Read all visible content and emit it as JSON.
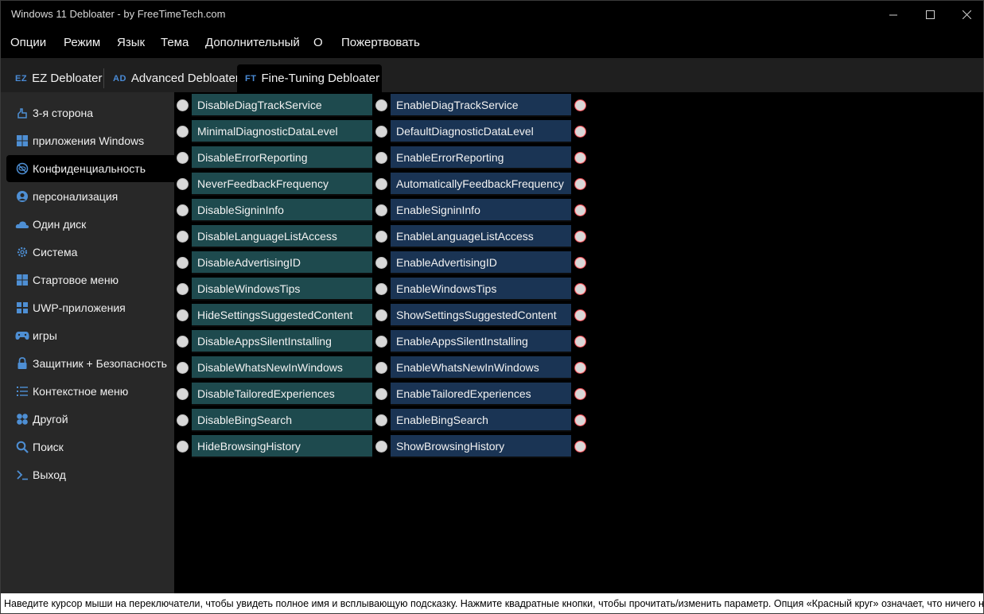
{
  "window": {
    "title": "Windows 11 Debloater - by FreeTimeTech.com"
  },
  "menu": [
    "Опции",
    "Режим",
    "Язык",
    "Тема",
    "Дополнительный",
    "О",
    "Пожертвовать"
  ],
  "tabs": [
    {
      "icon": "EZ",
      "label": "EZ Debloater"
    },
    {
      "icon": "AD",
      "label": "Advanced Debloater"
    },
    {
      "icon": "FT",
      "label": "Fine-Tuning Debloater"
    }
  ],
  "sidebar": [
    {
      "label": "3-я сторона",
      "icon": "hand-icon"
    },
    {
      "label": "приложения Windows",
      "icon": "windows-icon"
    },
    {
      "label": "Конфиденциальность",
      "icon": "privacy-eye-icon"
    },
    {
      "label": "персонализация",
      "icon": "person-icon"
    },
    {
      "label": "Один диск",
      "icon": "cloud-icon"
    },
    {
      "label": "Система",
      "icon": "gear-icon"
    },
    {
      "label": "Стартовое меню",
      "icon": "start-menu-icon"
    },
    {
      "label": "UWP-приложения",
      "icon": "apps-icon"
    },
    {
      "label": "игры",
      "icon": "gamepad-icon"
    },
    {
      "label": "Защитник + Безопасность",
      "icon": "lock-icon"
    },
    {
      "label": "Контекстное меню",
      "icon": "list-icon"
    },
    {
      "label": "Другой",
      "icon": "other-icon"
    },
    {
      "label": "Поиск",
      "icon": "search-icon"
    },
    {
      "label": "Выход",
      "icon": "terminal-icon"
    }
  ],
  "options": [
    {
      "disable": "DisableDiagTrackService",
      "enable": "EnableDiagTrackService"
    },
    {
      "disable": "MinimalDiagnosticDataLevel",
      "enable": "DefaultDiagnosticDataLevel"
    },
    {
      "disable": "DisableErrorReporting",
      "enable": "EnableErrorReporting"
    },
    {
      "disable": "NeverFeedbackFrequency",
      "enable": "AutomaticallyFeedbackFrequency"
    },
    {
      "disable": "DisableSigninInfo",
      "enable": "EnableSigninInfo"
    },
    {
      "disable": "DisableLanguageListAccess",
      "enable": "EnableLanguageListAccess"
    },
    {
      "disable": "DisableAdvertisingID",
      "enable": "EnableAdvertisingID"
    },
    {
      "disable": "DisableWindowsTips",
      "enable": "EnableWindowsTips"
    },
    {
      "disable": "HideSettingsSuggestedContent",
      "enable": "ShowSettingsSuggestedContent"
    },
    {
      "disable": "DisableAppsSilentInstalling",
      "enable": "EnableAppsSilentInstalling"
    },
    {
      "disable": "DisableWhatsNewInWindows",
      "enable": "EnableWhatsNewInWindows"
    },
    {
      "disable": "DisableTailoredExperiences",
      "enable": "EnableTailoredExperiences"
    },
    {
      "disable": "DisableBingSearch",
      "enable": "EnableBingSearch"
    },
    {
      "disable": "HideBrowsingHistory",
      "enable": "ShowBrowsingHistory"
    }
  ],
  "status": "Наведите курсор мыши на переключатели, чтобы увидеть полное имя и всплывающую подсказку. Нажмите квадратные кнопки, чтобы прочитать/изменить параметр. Опция «Красный круг» означает, что ничего не выбра",
  "colors": {
    "disable_button": "#1e4a4e",
    "enable_button": "#1a3454",
    "accent": "#4e8fd4",
    "red_circle": "#e0474f"
  }
}
